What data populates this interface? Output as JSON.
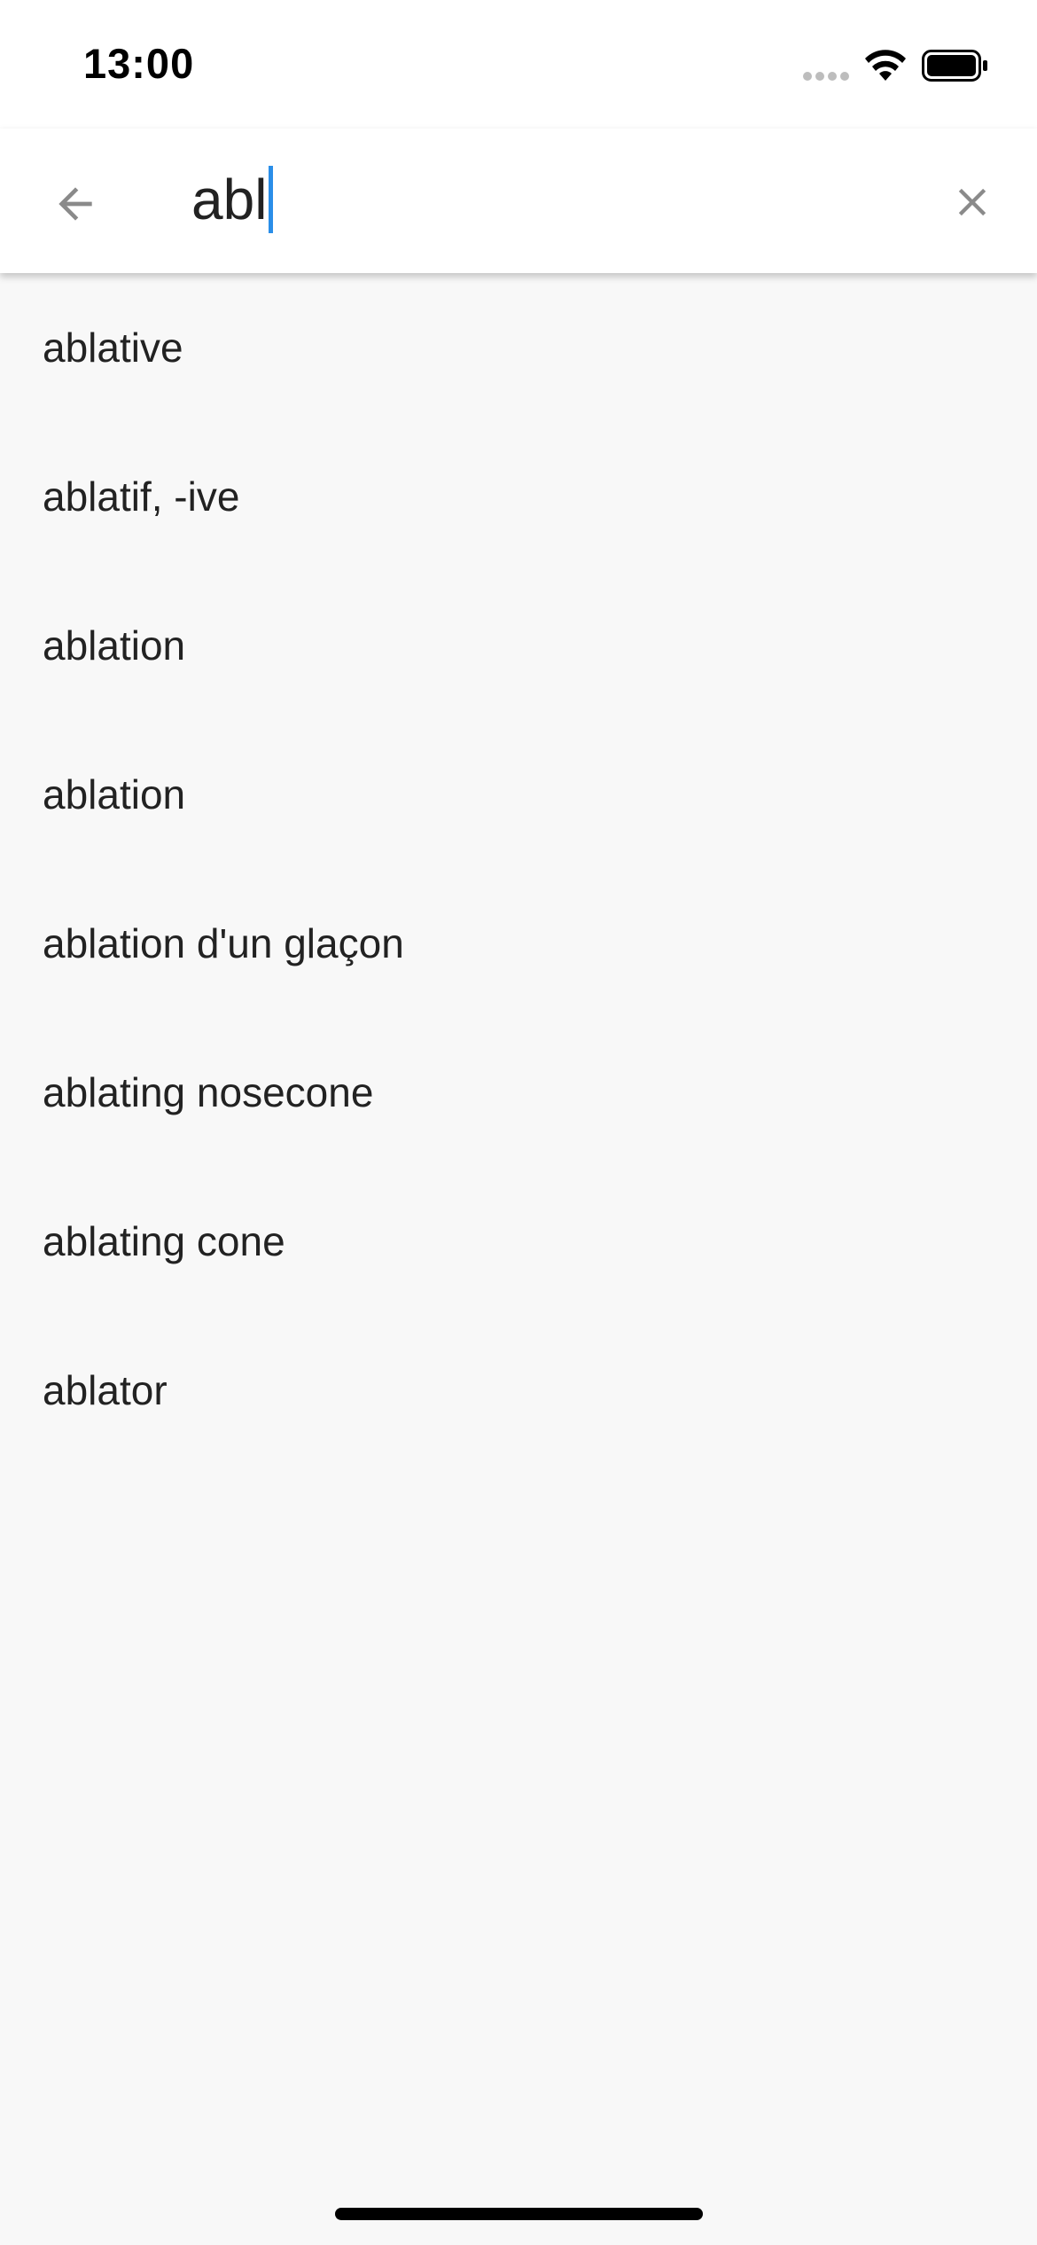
{
  "status_bar": {
    "time": "13:00",
    "icons": [
      "cellular-signal-icon",
      "wifi-icon",
      "battery-icon"
    ]
  },
  "search": {
    "query": "abl",
    "back_icon": "arrow-back-icon",
    "clear_icon": "close-icon"
  },
  "results": [
    {
      "label": "ablative"
    },
    {
      "label": "ablatif, -ive"
    },
    {
      "label": "ablation"
    },
    {
      "label": "ablation"
    },
    {
      "label": "ablation d'un glaçon"
    },
    {
      "label": "ablating nosecone"
    },
    {
      "label": "ablating cone"
    },
    {
      "label": "ablator"
    }
  ],
  "colors": {
    "accent": "#2a8ee8",
    "text": "#222222",
    "icon": "#8a8a8a",
    "background": "#f8f8f8",
    "app_bar": "#ffffff"
  }
}
